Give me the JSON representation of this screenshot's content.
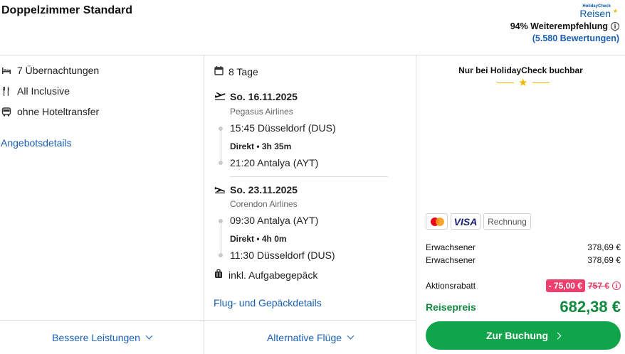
{
  "header": {
    "title": "Doppelzimmer Standard",
    "logo_small": "HolidayCheck",
    "logo_big": "Reisen",
    "recommendation": "94% Weiterempfehlung",
    "reviews": "(5.580 Bewertungen)"
  },
  "features": {
    "items": [
      {
        "icon": "bed-icon",
        "label": "7 Übernachtungen"
      },
      {
        "icon": "cutlery-icon",
        "label": "All Inclusive"
      },
      {
        "icon": "bus-icon",
        "label": "ohne Hoteltransfer"
      }
    ],
    "offer_link": "Angebotsdetails",
    "bottom_link": "Bessere Leistungen"
  },
  "flights": {
    "duration": "8 Tage",
    "outbound": {
      "date": "So. 16.11.2025",
      "airline": "Pegasus Airlines",
      "departure": "15:45 Düsseldorf (DUS)",
      "direct": "Direkt • 3h 35m",
      "arrival": "21:20 Antalya (AYT)"
    },
    "inbound": {
      "date": "So. 23.11.2025",
      "airline": "Corendon Airlines",
      "departure": "09:30 Antalya (AYT)",
      "direct": "Direkt • 4h 0m",
      "arrival": "11:30 Düsseldorf (DUS)"
    },
    "baggage": "inkl. Aufgabegepäck",
    "details_link": "Flug- und Gepäckdetails",
    "bottom_link": "Alternative Flüge"
  },
  "booking": {
    "exclusive": "Nur bei HolidayCheck buchbar",
    "payments": {
      "visa": "VISA",
      "invoice": "Rechnung"
    },
    "travelers": [
      {
        "label": "Erwachsener",
        "price": "378,69 €"
      },
      {
        "label": "Erwachsener",
        "price": "378,69 €"
      }
    ],
    "discount_label": "Aktionsrabatt",
    "discount_value": "- 75,00 €",
    "old_price": "757 €",
    "total_label": "Reisepreis",
    "total_price": "682,38 €",
    "cta": "Zur Buchung"
  },
  "colors": {
    "accent": "#1a5fb4",
    "success": "#12a44a",
    "discount": "#ee3f6e"
  }
}
